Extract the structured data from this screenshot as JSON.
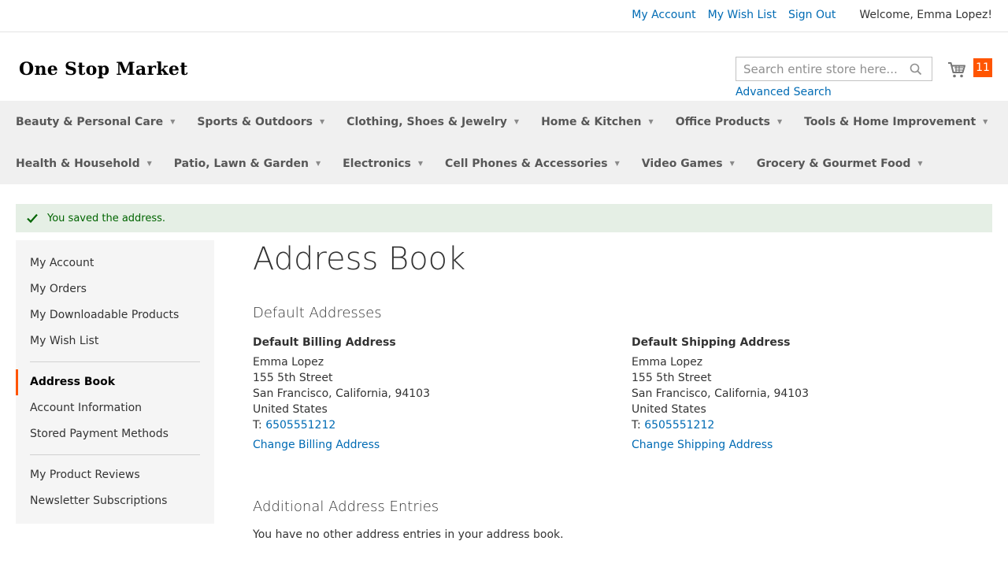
{
  "topbar": {
    "my_account": "My Account",
    "my_wish_list": "My Wish List",
    "sign_out": "Sign Out",
    "welcome": "Welcome, Emma Lopez!"
  },
  "header": {
    "logo": "One Stop Market",
    "search_placeholder": "Search entire store here...",
    "advanced_search": "Advanced Search",
    "cart_count": "11"
  },
  "nav": {
    "row1": [
      "Beauty & Personal Care",
      "Sports & Outdoors",
      "Clothing, Shoes & Jewelry",
      "Home & Kitchen",
      "Office Products",
      "Tools & Home Improvement"
    ],
    "row2": [
      "Health & Household",
      "Patio, Lawn & Garden",
      "Electronics",
      "Cell Phones & Accessories",
      "Video Games",
      "Grocery & Gourmet Food"
    ]
  },
  "message": "You saved the address.",
  "sidebar": {
    "items": [
      "My Account",
      "My Orders",
      "My Downloadable Products",
      "My Wish List",
      "Address Book",
      "Account Information",
      "Stored Payment Methods",
      "My Product Reviews",
      "Newsletter Subscriptions"
    ]
  },
  "main": {
    "title": "Address Book",
    "default_addresses": "Default Addresses",
    "billing": {
      "heading": "Default Billing Address",
      "name": "Emma Lopez",
      "street": "155 5th Street",
      "city": "San Francisco, California, 94103",
      "country": "United States",
      "phone_prefix": "T: ",
      "phone": "6505551212",
      "change": "Change Billing Address"
    },
    "shipping": {
      "heading": "Default Shipping Address",
      "name": "Emma Lopez",
      "street": "155 5th Street",
      "city": "San Francisco, California, 94103",
      "country": "United States",
      "phone_prefix": "T: ",
      "phone": "6505551212",
      "change": "Change Shipping Address"
    },
    "additional_title": "Additional Address Entries",
    "additional_empty": "You have no other address entries in your address book."
  },
  "colors": {
    "link": "#006bb4",
    "accent": "#ff5501",
    "success_bg": "#e5efe5",
    "success_text": "#006400"
  }
}
